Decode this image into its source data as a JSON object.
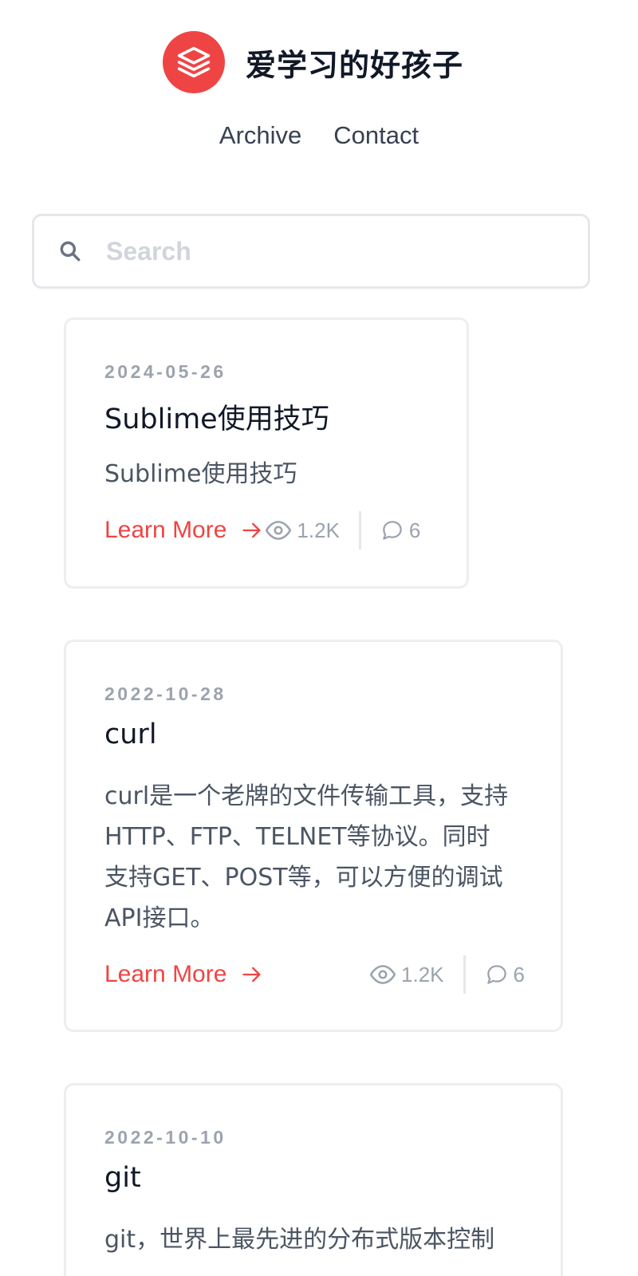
{
  "site": {
    "title": "爱学习的好孩子",
    "logo_icon": "layers-icon",
    "accent_color": "#ef4444"
  },
  "nav": {
    "items": [
      {
        "label": "Archive"
      },
      {
        "label": "Contact"
      }
    ]
  },
  "search": {
    "placeholder": "Search",
    "value": ""
  },
  "posts": [
    {
      "date": "2024-05-26",
      "title": "Sublime使用技巧",
      "excerpt": "Sublime使用技巧",
      "learn_more": "Learn More",
      "views": "1.2K",
      "comments": "6"
    },
    {
      "date": "2022-10-28",
      "title": "curl",
      "excerpt_lines": [
        "curl是一个老牌的文件传输工具，支持",
        "HTTP、FTP、TELNET等协议。同时",
        "支持GET、POST等，可以方便的调试",
        "API接口。"
      ],
      "learn_more": "Learn More",
      "views": "1.2K",
      "comments": "6"
    },
    {
      "date": "2022-10-10",
      "title": "git",
      "excerpt_lines": [
        "git，世界上最先进的分布式版本控制"
      ]
    }
  ]
}
